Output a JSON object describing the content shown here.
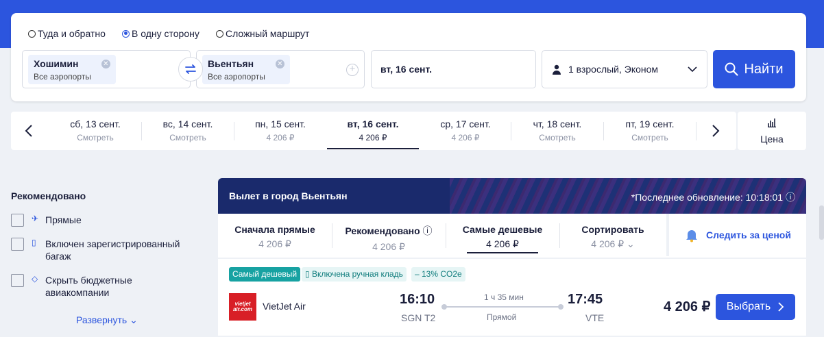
{
  "search": {
    "trip_types": [
      "Туда и обратно",
      "В одну сторону",
      "Сложный маршрут"
    ],
    "selected_trip": 1,
    "from_city": "Хошимин",
    "from_sub": "Все аэропорты",
    "to_city": "Вьентьян",
    "to_sub": "Все аэропорты",
    "date": "вт, 16 сент.",
    "passengers": "1 взрослый, Эконом",
    "search_label": "Найти"
  },
  "dates": [
    {
      "day": "сб, 13 сент.",
      "price": "Смотреть"
    },
    {
      "day": "вс, 14 сент.",
      "price": "Смотреть"
    },
    {
      "day": "пн, 15 сент.",
      "price": "4 206 ₽"
    },
    {
      "day": "вт, 16 сент.",
      "price": "4 206 ₽"
    },
    {
      "day": "ср, 17 сент.",
      "price": "4 206 ₽"
    },
    {
      "day": "чт, 18 сент.",
      "price": "Смотреть"
    },
    {
      "day": "пт, 19 сент.",
      "price": "Смотреть"
    }
  ],
  "active_date": 3,
  "price_button_label": "Цена",
  "filters": {
    "title": "Рекомендовано",
    "items": [
      "Прямые",
      "Включен зарегистрированный багаж",
      "Скрыть бюджетные авиакомпании"
    ],
    "expand_label": "Развернуть"
  },
  "results": {
    "header_title": "Вылет в город Вьентьян",
    "last_update": "*Последнее обновление: 10:18:01",
    "sort_tabs": [
      {
        "label": "Сначала прямые",
        "price": "4 206 ₽"
      },
      {
        "label": "Рекомендовано",
        "price": "4 206 ₽"
      },
      {
        "label": "Самые дешевые",
        "price": "4 206 ₽"
      },
      {
        "label": "Сортировать",
        "price": "4 206 ₽"
      }
    ],
    "active_sort": 2,
    "follow_label": "Следить за ценой",
    "flight": {
      "badges": [
        "Самый дешевый",
        "Включена ручная кладь",
        "– 13% CO2e"
      ],
      "airline": "VietJet Air",
      "logo_text": "vietjet air.com",
      "dep_time": "16:10",
      "dep_airport": "SGN T2",
      "duration": "1 ч 35 мин",
      "stops": "Прямой",
      "arr_time": "17:45",
      "arr_airport": "VTE",
      "price": "4 206 ₽",
      "select_label": "Выбрать"
    }
  },
  "colors": {
    "accent": "#2c55de",
    "header_bg": "#1a2a6c",
    "badge": "#17a2a2",
    "logo": "#d81f26"
  }
}
